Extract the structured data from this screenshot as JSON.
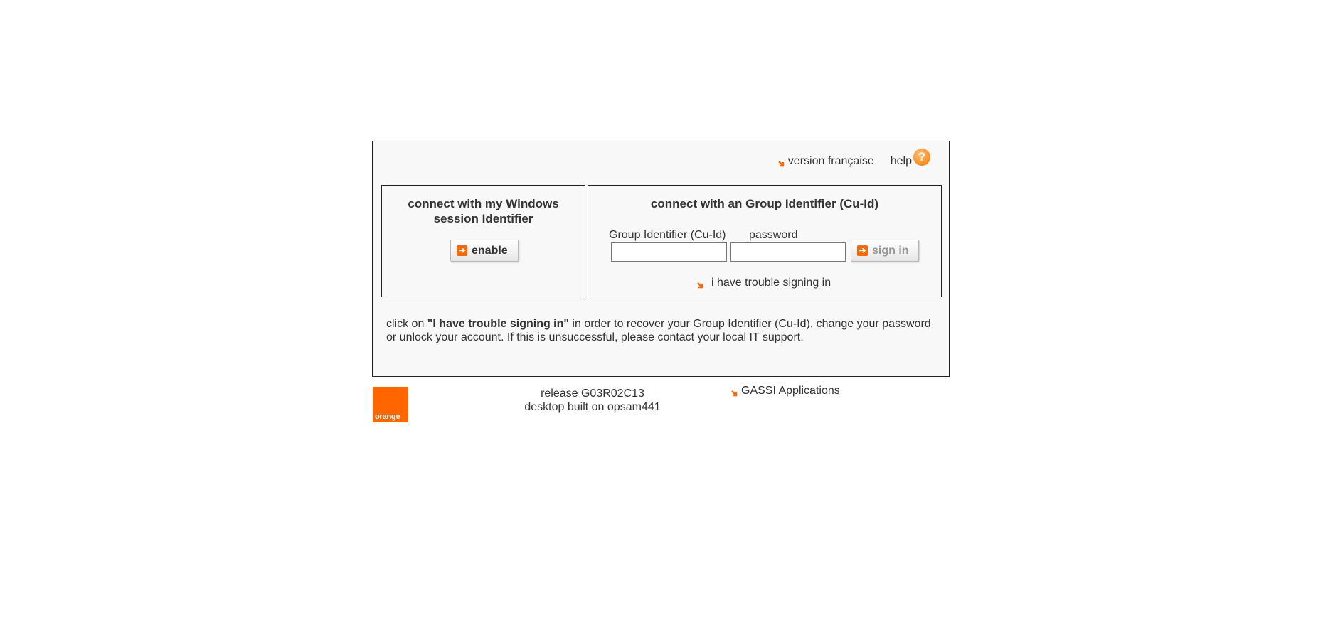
{
  "header": {
    "version_link": "version française",
    "help_label": "help",
    "help_icon": "?"
  },
  "windows_box": {
    "title": "connect with my Windows session Identifier",
    "enable_button": "enable"
  },
  "group_box": {
    "title": "connect with an Group Identifier (Cu-Id)",
    "id_label": "Group Identifier (Cu-Id)",
    "id_value": "",
    "password_label": "password",
    "password_value": "",
    "signin_button": "sign in",
    "trouble_link": "i have trouble signing in"
  },
  "help_text": {
    "prefix": "click on ",
    "emphasis": "\"I have trouble signing in\"",
    "suffix": " in order to recover your Group Identifier (Cu-Id), change your password or unlock your account. If this is unsuccessful, please contact your local IT support."
  },
  "footer": {
    "logo_text": "orange",
    "release": "release G03R02C13",
    "built_on": "desktop built on opsam441",
    "gassi_link": "GASSI Applications"
  },
  "colors": {
    "brand_orange": "#ff6600",
    "panel_bg": "#f8f8f8",
    "text": "#333333"
  }
}
